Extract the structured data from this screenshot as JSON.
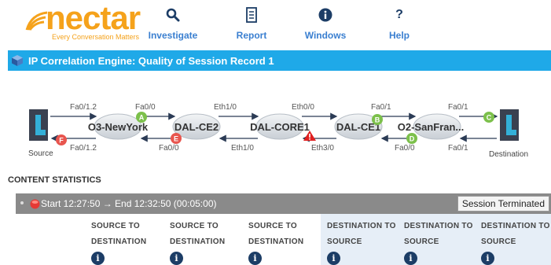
{
  "logo": {
    "word": "nectar",
    "tagline": "Every Conversation Matters"
  },
  "nav": [
    {
      "label": "Investigate",
      "icon": "search-icon"
    },
    {
      "label": "Report",
      "icon": "report-icon"
    },
    {
      "label": "Windows",
      "icon": "info-icon"
    },
    {
      "label": "Help",
      "icon": "question-icon"
    }
  ],
  "title": "IP Correlation Engine: Quality of Session Record 1",
  "diagram": {
    "source_label": "Source",
    "destination_label": "Destination",
    "nodes": [
      "O3-NewYork",
      "DAL-CE2",
      "DAL-CORE1",
      "DAL-CE1",
      "O2-SanFran..."
    ],
    "top_ports": [
      "Fa0/1.2",
      "Fa0/0",
      "Eth1/0",
      "Eth0/0",
      "Fa0/1",
      "Fa0/1"
    ],
    "bottom_ports": [
      "Fa0/1.2",
      "Fa0/0",
      "Eth1/0",
      "Eth3/0",
      "Fa0/0",
      "Fa0/1"
    ],
    "badges": [
      {
        "letter": "A",
        "color": "#7cc04b"
      },
      {
        "letter": "B",
        "color": "#7cc04b"
      },
      {
        "letter": "C",
        "color": "#7cc04b"
      },
      {
        "letter": "D",
        "color": "#7cc04b"
      },
      {
        "letter": "E",
        "color": "#e8554e"
      },
      {
        "letter": "F",
        "color": "#e8554e"
      }
    ],
    "warning_color": "#e02020"
  },
  "stats": {
    "section_title": "CONTENT STATISTICS",
    "session_range": "Start 12:27:50 → End 12:32:50 (00:05:00)",
    "session_status": "Session Terminated",
    "columns": [
      {
        "line1": "SOURCE TO",
        "line2": "DESTINATION"
      },
      {
        "line1": "SOURCE TO",
        "line2": "DESTINATION"
      },
      {
        "line1": "SOURCE TO",
        "line2": "DESTINATION"
      },
      {
        "line1": "DESTINATION TO",
        "line2": "SOURCE"
      },
      {
        "line1": "DESTINATION TO",
        "line2": "SOURCE"
      },
      {
        "line1": "DESTINATION TO",
        "line2": "SOURCE"
      }
    ],
    "info_glyph": "i"
  },
  "colors": {
    "brand": "#f5a21b",
    "nav_text": "#3a7fd0",
    "title_bar": "#1fa9e8",
    "header_bar": "#8a8a8a",
    "dest_column_bg": "#e6eef7"
  }
}
